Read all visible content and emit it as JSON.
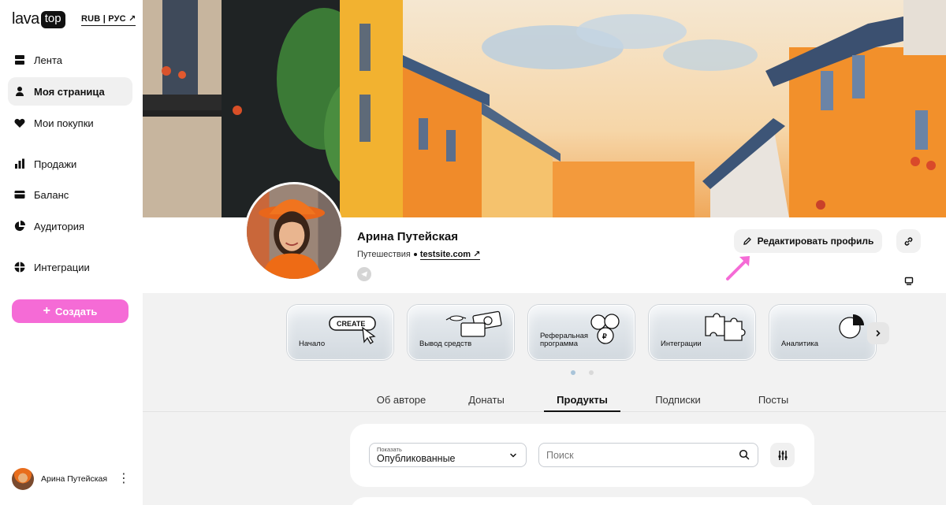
{
  "brand": {
    "name": "lava",
    "badge": "top"
  },
  "currency_lang": "RUB | РУС ↗",
  "sidebar": {
    "items": [
      {
        "label": "Лента",
        "icon": "feed-icon"
      },
      {
        "label": "Моя страница",
        "icon": "person-icon",
        "active": true
      },
      {
        "label": "Мои покупки",
        "icon": "heart-icon"
      },
      {
        "label": "Продажи",
        "icon": "bar-chart-icon"
      },
      {
        "label": "Баланс",
        "icon": "card-icon"
      },
      {
        "label": "Аудитория",
        "icon": "pie-chart-icon"
      },
      {
        "label": "Интеграции",
        "icon": "integrations-icon"
      }
    ],
    "create_label": "Создать",
    "user_name": "Арина Путейская"
  },
  "profile": {
    "name": "Арина Путейская",
    "category": "Путешествия",
    "site": "testsite.com",
    "edit_label": "Редактировать профиль"
  },
  "cards": [
    {
      "label": "Начало",
      "illustration": "create-button-icon",
      "badge_text": "CREATE"
    },
    {
      "label": "Вывод средств",
      "illustration": "money-icon"
    },
    {
      "label": "Реферальная\nпрограмма",
      "illustration": "coins-icon"
    },
    {
      "label": "Интеграции",
      "illustration": "puzzle-icon"
    },
    {
      "label": "Аналитика",
      "illustration": "pie-icon"
    }
  ],
  "tabs": [
    {
      "label": "Об авторе"
    },
    {
      "label": "Донаты"
    },
    {
      "label": "Продукты",
      "active": true
    },
    {
      "label": "Подписки"
    },
    {
      "label": "Посты"
    }
  ],
  "filter": {
    "show_caption": "Показать",
    "show_value": "Опубликованные",
    "search_placeholder": "Поиск"
  },
  "colors": {
    "accent": "#f56bd6",
    "dot_active": "#a9c4d9"
  }
}
